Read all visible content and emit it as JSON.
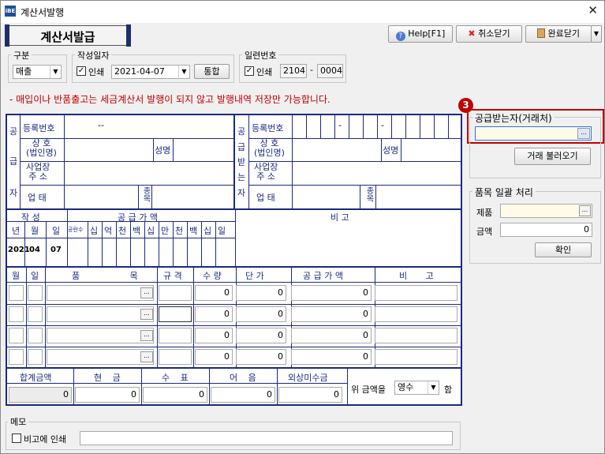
{
  "window": {
    "title": "계산서발행",
    "close_glyph": "✕",
    "icon_text": "iBE"
  },
  "header": {
    "form_title": "계산서발급"
  },
  "toolbar": {
    "help_label": "Help[F1]",
    "cancel_label": "취소닫기",
    "done_label": "완료닫기"
  },
  "filters": {
    "category_group": "구분",
    "category_value": "매출",
    "date_group": "작성일자",
    "date_print_label": "인쇄",
    "date_value": "2021-04-07",
    "merge_label": "통합",
    "serial_group": "일련번호",
    "serial_print_label": "인쇄",
    "serial_a": "2104",
    "serial_b": "0004",
    "dash": "-"
  },
  "notice": "- 매입이나 반품출고는 세금계산서 발행이 되지 않고 발행내역 저장만 가능합니다.",
  "supplier": {
    "side_label": [
      "공",
      "급",
      "자"
    ],
    "reg_no_label": "등록번호",
    "reg_no_value": "--",
    "company_label": "상 호\n(법인명)",
    "ceo_label": "성명",
    "address_label": "사업장\n주 소",
    "biz_type_label": "업 태",
    "biz_item_label": "종목"
  },
  "buyer": {
    "side_label": [
      "공",
      "급",
      "받",
      "는",
      "자"
    ],
    "reg_no_label": "등록번호",
    "dash": "-",
    "company_label": "상 호\n(법인명)",
    "ceo_label": "성명",
    "address_label": "사업장\n주 소",
    "biz_type_label": "업 태",
    "biz_item_label": "종목"
  },
  "summary": {
    "written_label": "작 성",
    "supply_label": "공 급 가 액",
    "remarks_label": "비 고",
    "date_headers": [
      "년",
      "월",
      "일"
    ],
    "blank_count_label": "공란수",
    "digit_headers": [
      "십",
      "억",
      "천",
      "백",
      "십",
      "만",
      "천",
      "백",
      "십",
      "일"
    ],
    "year": "2021",
    "month": "04",
    "day": "07"
  },
  "items": {
    "headers": [
      "월",
      "일",
      "품 목",
      "규 격",
      "수 량",
      "단 가",
      "공 급 가 액",
      "비 고"
    ],
    "rows": [
      {
        "qty": "0",
        "price": "0",
        "amount": "0"
      },
      {
        "qty": "0",
        "price": "0",
        "amount": "0"
      },
      {
        "qty": "0",
        "price": "0",
        "amount": "0"
      },
      {
        "qty": "0",
        "price": "0",
        "amount": "0"
      }
    ],
    "ellipsis": "..."
  },
  "totals": {
    "headers": [
      "합계금액",
      "현 금",
      "수 표",
      "어 음",
      "외상미수금"
    ],
    "values": [
      "0",
      "0",
      "0",
      "0",
      "0"
    ],
    "tail_prefix": "위 금액을",
    "tail_select": "영수",
    "tail_suffix": "함"
  },
  "right_panel": {
    "step_badge": "3",
    "buyer_group": "공급받는자(거래처)",
    "buyer_value": "",
    "load_button": "거래 불러오기",
    "bulk_group": "품목 일괄 처리",
    "product_label": "제품",
    "product_value": "",
    "amount_label": "금액",
    "amount_value": "0",
    "confirm_button": "확인"
  },
  "memo": {
    "group": "메모",
    "print_label": "비고에 인쇄",
    "value": ""
  },
  "colors": {
    "form_blue": "#1a2a80",
    "accent_red": "#c00000",
    "notice_red": "#c00000",
    "highlight": "#fffbe8"
  }
}
